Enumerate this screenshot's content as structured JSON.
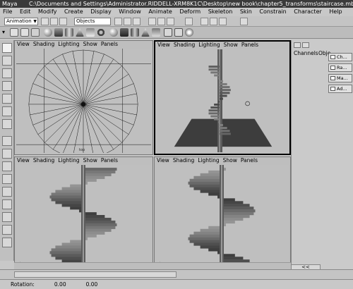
{
  "window": {
    "app": "Maya",
    "path": "C:\\Documents and Settings\\Administrator.RIDDELL-XRM8K1C\\Desktop\\new book\\chapter5_transforms\\staircase.mb"
  },
  "menu": [
    "File",
    "Edit",
    "Modify",
    "Create",
    "Display",
    "Window",
    "Animate",
    "Deform",
    "Skeleton",
    "Skin",
    "Constrain",
    "Character",
    "Help"
  ],
  "toolbar": {
    "menuset": "Animation",
    "selection_mode": "Objects"
  },
  "panel_menu": {
    "view": "View",
    "shading": "Shading",
    "lighting": "Lighting",
    "show": "Show",
    "panels": "Panels"
  },
  "viewports": [
    {
      "id": "top",
      "label": "top"
    },
    {
      "id": "persp"
    },
    {
      "id": "front"
    },
    {
      "id": "side"
    }
  ],
  "channel_box": {
    "tabs": [
      "Channels",
      "Obje"
    ],
    "side_buttons": [
      "Ch...",
      "Ra...",
      "Ma...",
      "Ad..."
    ]
  },
  "range": {
    "collapse": "<<"
  },
  "status": {
    "label": "Rotation:",
    "x": "0.00",
    "y": "0.00"
  },
  "colors": {
    "viewport_bg": "#bfbfbf",
    "titlebar": "#3a3a3a",
    "floor": "#3d3d3d"
  }
}
